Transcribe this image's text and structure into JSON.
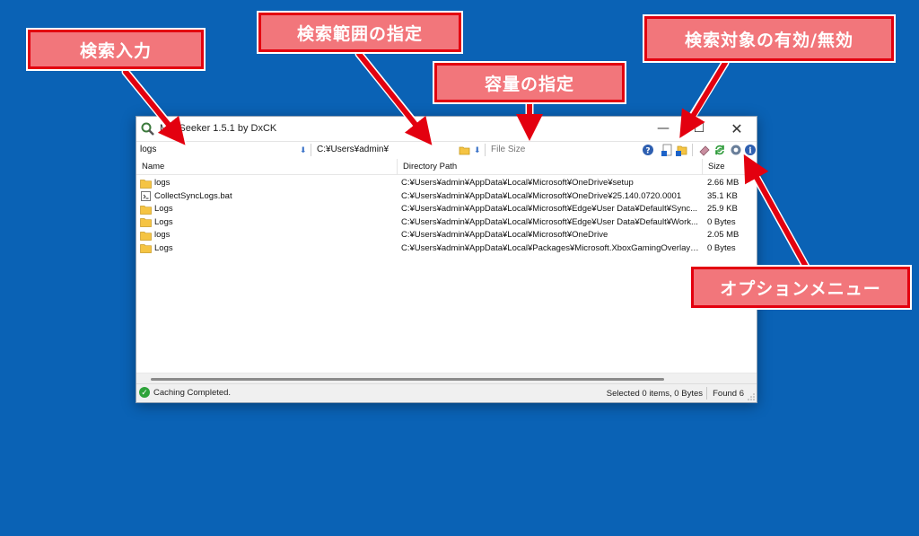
{
  "annotations": {
    "search_input": "検索入力",
    "search_scope": "検索範囲の指定",
    "size_filter": "容量の指定",
    "toggle_targets": "検索対象の有効/無効",
    "option_menu": "オプションメニュー"
  },
  "window": {
    "title": "MaaSeeker 1.5.1 by DxCK",
    "minimize_glyph": "—",
    "maximize_glyph": "☐",
    "close_glyph": "✕"
  },
  "toolbar": {
    "search_value": "logs",
    "path_value": "C:¥Users¥admin¥",
    "size_placeholder": "File Size"
  },
  "list": {
    "columns": [
      "Name",
      "Directory Path",
      "Size"
    ],
    "rows": [
      {
        "name": "logs",
        "type": "folder",
        "path": "C:¥Users¥admin¥AppData¥Local¥Microsoft¥OneDrive¥setup",
        "size": "2.66 MB"
      },
      {
        "name": "CollectSyncLogs.bat",
        "type": "bat",
        "path": "C:¥Users¥admin¥AppData¥Local¥Microsoft¥OneDrive¥25.140.0720.0001",
        "size": "35.1 KB"
      },
      {
        "name": "Logs",
        "type": "folder",
        "path": "C:¥Users¥admin¥AppData¥Local¥Microsoft¥Edge¥User Data¥Default¥Sync...",
        "size": "25.9 KB"
      },
      {
        "name": "Logs",
        "type": "folder",
        "path": "C:¥Users¥admin¥AppData¥Local¥Microsoft¥Edge¥User Data¥Default¥Work...",
        "size": "0 Bytes"
      },
      {
        "name": "logs",
        "type": "folder",
        "path": "C:¥Users¥admin¥AppData¥Local¥Microsoft¥OneDrive",
        "size": "2.05 MB"
      },
      {
        "name": "Logs",
        "type": "folder",
        "path": "C:¥Users¥admin¥AppData¥Local¥Packages¥Microsoft.XboxGamingOverlay_...",
        "size": "0 Bytes"
      }
    ]
  },
  "status": {
    "message": "Caching Completed.",
    "selected": "Selected 0 items, 0 Bytes",
    "found": "Found 6"
  },
  "colors": {
    "desktop": "#0a62b5",
    "callout_fill": "#f2767b",
    "callout_border": "#e3000f",
    "arrow": "#e3000f",
    "folder": "#f5c443"
  },
  "icons": [
    "help-icon",
    "file-toggle-icon",
    "folder-toggle-icon",
    "eraser-icon",
    "refresh-icon",
    "gear-icon",
    "info-icon",
    "folder-browse-icon"
  ]
}
